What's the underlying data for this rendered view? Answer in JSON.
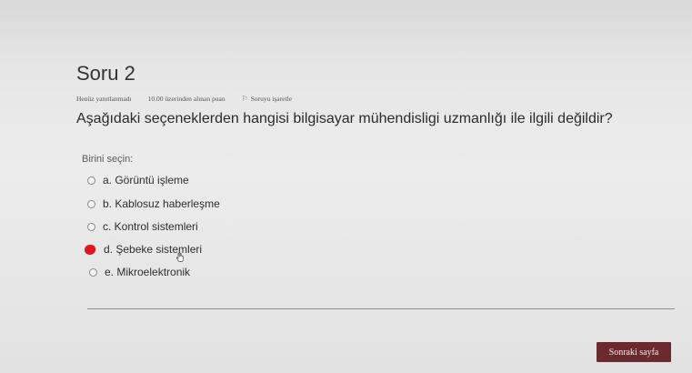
{
  "question": {
    "title": "Soru 2",
    "status": "Henüz yanıtlanmadı",
    "score": "10.00 üzerinden alınan puan",
    "flag_label": "Soruyu işaretle",
    "text": "Aşağıdaki seçeneklerden hangisi bilgisayar mühendisligi uzmanlığı ile ilgili değildir?",
    "prompt": "Birini seçin:",
    "options": [
      {
        "label": "a. Görüntü işleme",
        "selected": false
      },
      {
        "label": "b. Kablosuz haberleşme",
        "selected": false
      },
      {
        "label": "c. Kontrol sistemleri",
        "selected": false
      },
      {
        "label": "d. Şebeke sistemleri",
        "selected": true
      },
      {
        "label": "e. Mikroelektronik",
        "selected": false
      }
    ]
  },
  "footer": {
    "next_label": "Sonraki sayfa"
  },
  "colors": {
    "selected_mark": "#e01818",
    "button_bg": "#6b2a2e"
  },
  "icons": {
    "flag": "flag-icon",
    "cursor": "hand-cursor-icon"
  }
}
